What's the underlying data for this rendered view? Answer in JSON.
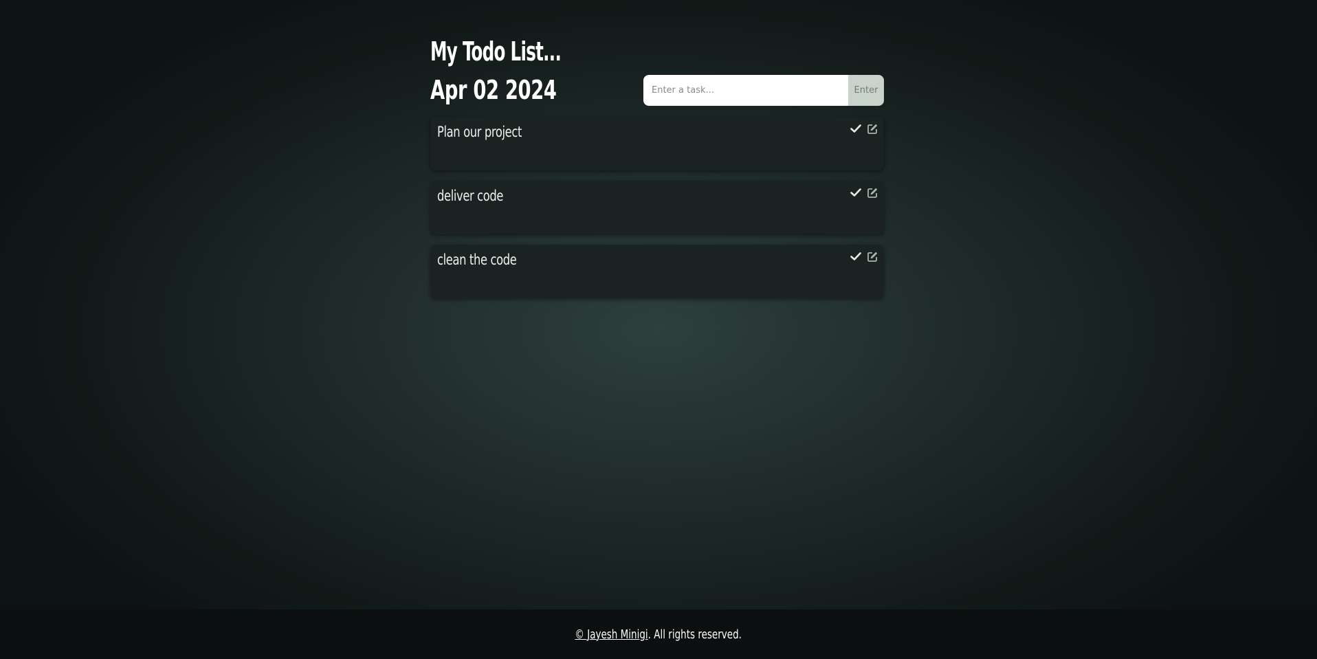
{
  "header": {
    "title": "My Todo List...",
    "date": "Apr 02 2024"
  },
  "form": {
    "placeholder": "Enter a task...",
    "submit_label": "Enter"
  },
  "tasks": [
    {
      "text": "Plan our project",
      "complete_icon": "check-icon",
      "edit_icon": "edit-icon"
    },
    {
      "text": "deliver code",
      "complete_icon": "check-icon",
      "edit_icon": "edit-icon"
    },
    {
      "text": "clean the code",
      "complete_icon": "check-icon",
      "edit_icon": "edit-icon"
    }
  ],
  "footer": {
    "author_link": "© Jayesh Minigi",
    "rights_text": ". All rights reserved."
  },
  "colors": {
    "check": "#e8ecea",
    "edit": "#a9b6b0",
    "card_bg": "#1b2322",
    "enter_bg": "#c9d3cc"
  }
}
